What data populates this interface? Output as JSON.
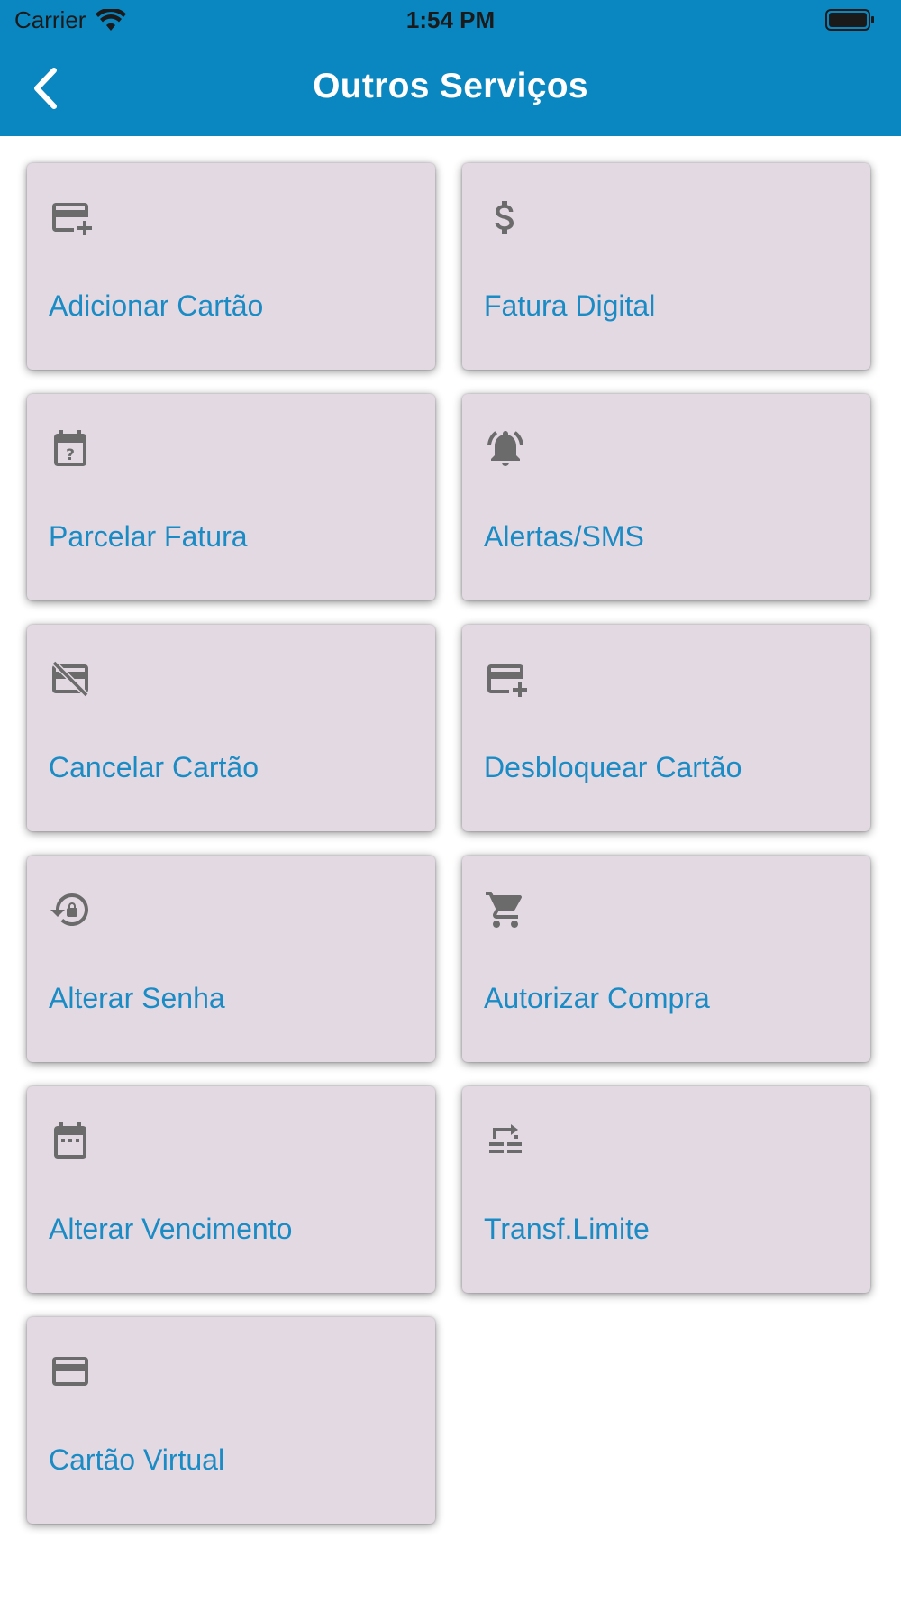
{
  "status_bar": {
    "carrier": "Carrier",
    "time": "1:54 PM",
    "wifi_icon": "wifi-icon",
    "battery_icon": "battery-icon"
  },
  "nav": {
    "title": "Outros Serviços",
    "back_icon": "chevron-left-icon"
  },
  "colors": {
    "header_bg": "#0a87c0",
    "card_bg": "#e3d9e2",
    "label": "#1a8bc4",
    "icon": "#6b6b6b"
  },
  "services": [
    {
      "label": "Adicionar Cartão",
      "icon": "add-card-icon"
    },
    {
      "label": "Fatura Digital",
      "icon": "dollar-icon"
    },
    {
      "label": "Parcelar Fatura",
      "icon": "calendar-question-icon"
    },
    {
      "label": "Alertas/SMS",
      "icon": "alarm-bell-icon"
    },
    {
      "label": "Cancelar Cartão",
      "icon": "card-off-icon"
    },
    {
      "label": "Desbloquear Cartão",
      "icon": "add-card-icon"
    },
    {
      "label": "Alterar Senha",
      "icon": "lock-reset-icon"
    },
    {
      "label": "Autorizar Compra",
      "icon": "cart-icon"
    },
    {
      "label": "Alterar Vencimento",
      "icon": "calendar-icon"
    },
    {
      "label": "Transf.Limite",
      "icon": "transfer-icon"
    },
    {
      "label": "Cartão Virtual",
      "icon": "credit-card-icon"
    }
  ]
}
